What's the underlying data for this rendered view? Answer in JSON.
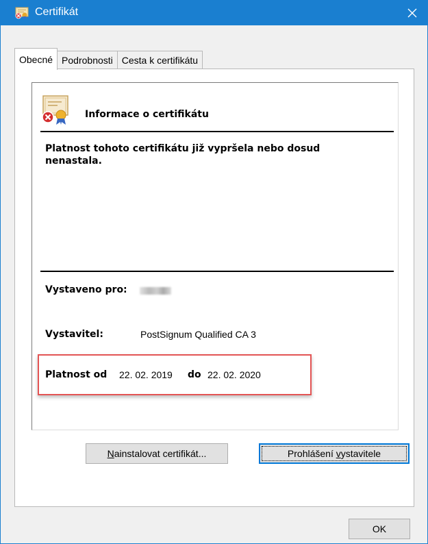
{
  "window": {
    "title": "Certifikát",
    "title_icon": "certificate-icon",
    "close_icon": "close-icon",
    "accent_color": "#1a7fd0"
  },
  "tabs": [
    {
      "label": "Obecné",
      "active": true
    },
    {
      "label": "Podrobnosti",
      "active": false
    },
    {
      "label": "Cesta k certifikátu",
      "active": false
    }
  ],
  "info": {
    "icon": "certificate-invalid-icon",
    "title": "Informace o certifikátu",
    "warning": "Platnost tohoto certifikátu již vypršela nebo dosud nenastala.",
    "issued_to_label": "Vystaveno pro:",
    "issuer_label": "Vystavitel:",
    "issuer_value": "PostSignum Qualified CA 3",
    "valid_from_label": "Platnost od",
    "valid_from_value": "22. 02. 2019",
    "valid_to_label": "do",
    "valid_to_value": "22. 02. 2020",
    "highlight_color": "#e35454"
  },
  "buttons": {
    "install_prefix": "",
    "install_mnemonic": "N",
    "install_rest": "ainstalovat certifikát...",
    "statement_prefix": "Prohlášení ",
    "statement_mnemonic": "v",
    "statement_rest": "ystavitele",
    "ok": "OK"
  }
}
